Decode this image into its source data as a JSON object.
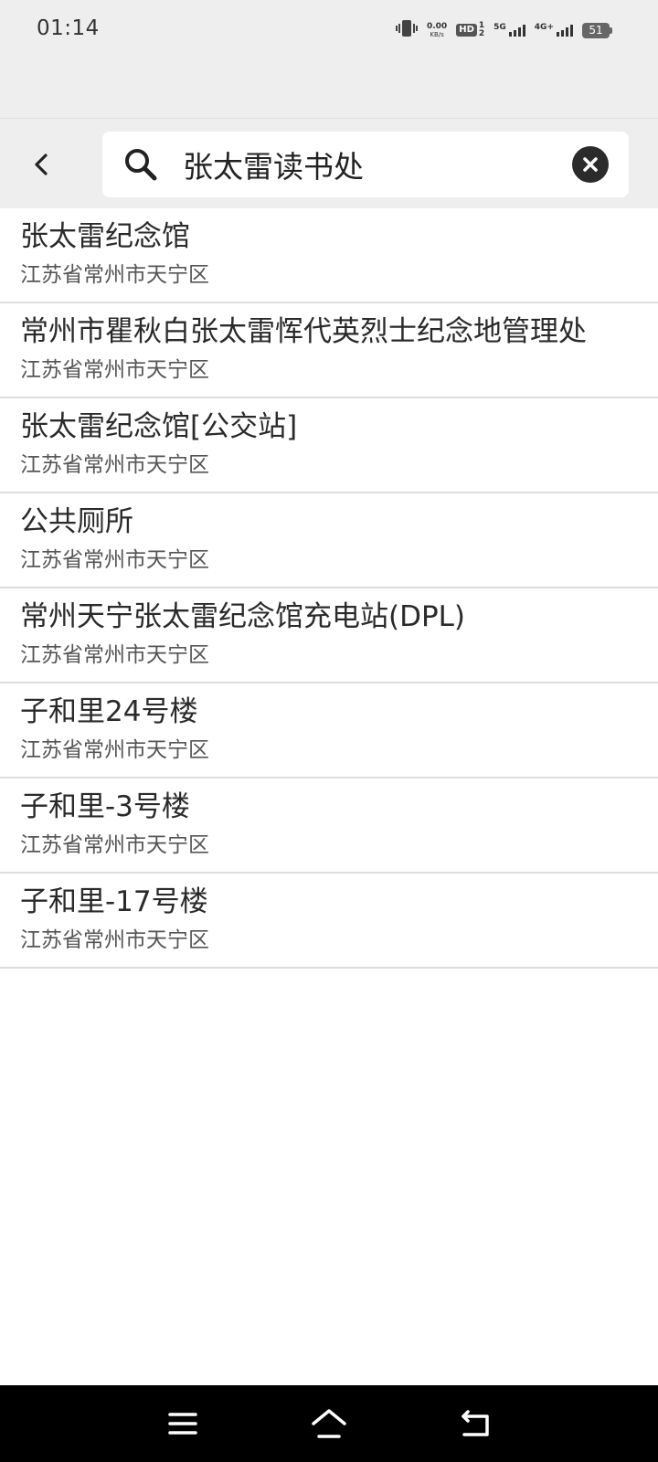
{
  "status_bar": {
    "time": "01:14",
    "net_speed_value": "0.00",
    "net_speed_unit": "KB/s",
    "hd_label": "HD",
    "hd_sub_top": "1",
    "hd_sub_bottom": "2",
    "sig1_label": "5G",
    "sig2_label": "4G+",
    "battery": "51",
    "icons": [
      "vibrate-icon",
      "hd-volte-icon",
      "signal-5g-icon",
      "signal-4g-icon",
      "battery-icon"
    ]
  },
  "search": {
    "query": "张太雷读书处"
  },
  "results": [
    {
      "title": "张太雷纪念馆",
      "subtitle": "江苏省常州市天宁区"
    },
    {
      "title": "常州市瞿秋白张太雷恽代英烈士纪念地管理处",
      "subtitle": "江苏省常州市天宁区"
    },
    {
      "title": "张太雷纪念馆[公交站]",
      "subtitle": "江苏省常州市天宁区"
    },
    {
      "title": "公共厕所",
      "subtitle": "江苏省常州市天宁区"
    },
    {
      "title": "常州天宁张太雷纪念馆充电站(DPL)",
      "subtitle": "江苏省常州市天宁区"
    },
    {
      "title": "子和里24号楼",
      "subtitle": "江苏省常州市天宁区"
    },
    {
      "title": "子和里-3号楼",
      "subtitle": "江苏省常州市天宁区"
    },
    {
      "title": "子和里-17号楼",
      "subtitle": "江苏省常州市天宁区"
    }
  ],
  "colors": {
    "header_bg": "#eeeeee",
    "divider": "#dddddd",
    "nav_bg": "#000000"
  }
}
